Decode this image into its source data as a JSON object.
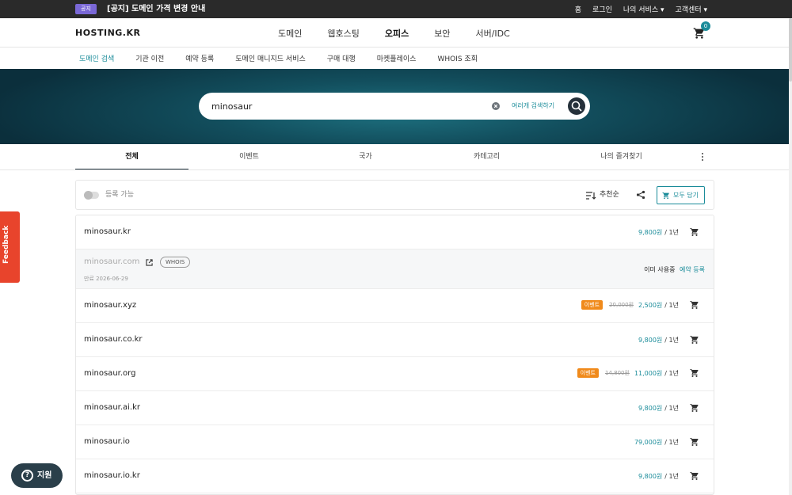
{
  "topbar": {
    "notice_badge": "공지",
    "notice_text": "[공지] 도메인 가격 변경 안내",
    "links": [
      "홈",
      "로그인",
      "나의 서비스 ▾",
      "고객센터 ▾"
    ]
  },
  "header": {
    "logo": "HOSTING.KR",
    "nav": [
      "도메인",
      "웹호스팅",
      "오피스",
      "보안",
      "서버/IDC"
    ],
    "cart_count": "0"
  },
  "subnav": [
    "도메인 검색",
    "기관 이전",
    "예약 등록",
    "도메인 매니지드 서비스",
    "구매 대행",
    "마켓플레이스",
    "WHOIS 조회"
  ],
  "search": {
    "value": "minosaur",
    "multi_search_label": "여러개 검색하기"
  },
  "tabs": [
    "전체",
    "이벤트",
    "국가",
    "카테고리",
    "나의 즐겨찾기"
  ],
  "filter": {
    "toggle_label": "등록 가능",
    "sort_label": "추천순",
    "add_all_label": "모두 담기"
  },
  "results": [
    {
      "domain": "minosaur.kr",
      "price": "9,800원",
      "period": "/ 1년"
    },
    {
      "domain": "minosaur.com",
      "taken": true,
      "whois": "WHOIS",
      "expire": "만료 2026-06-29",
      "taken_label": "이미 사용중",
      "reserve_label": "예약 등록"
    },
    {
      "domain": "minosaur.xyz",
      "event": "이벤트",
      "orig_price": "20,000원",
      "price": "2,500원",
      "period": "/ 1년"
    },
    {
      "domain": "minosaur.co.kr",
      "price": "9,800원",
      "period": "/ 1년"
    },
    {
      "domain": "minosaur.org",
      "event": "이벤트",
      "orig_price": "14,800원",
      "price": "11,000원",
      "period": "/ 1년"
    },
    {
      "domain": "minosaur.ai.kr",
      "price": "9,800원",
      "period": "/ 1년"
    },
    {
      "domain": "minosaur.io",
      "price": "79,000원",
      "period": "/ 1년"
    },
    {
      "domain": "minosaur.io.kr",
      "price": "9,800원",
      "period": "/ 1년"
    }
  ],
  "floating": {
    "feedback_label": "Feedback",
    "support_label": "지원"
  },
  "colors": {
    "accent": "#1b8c9a",
    "event": "#f08a1b",
    "notice": "#7a68d6",
    "feedback": "#e8442c"
  }
}
